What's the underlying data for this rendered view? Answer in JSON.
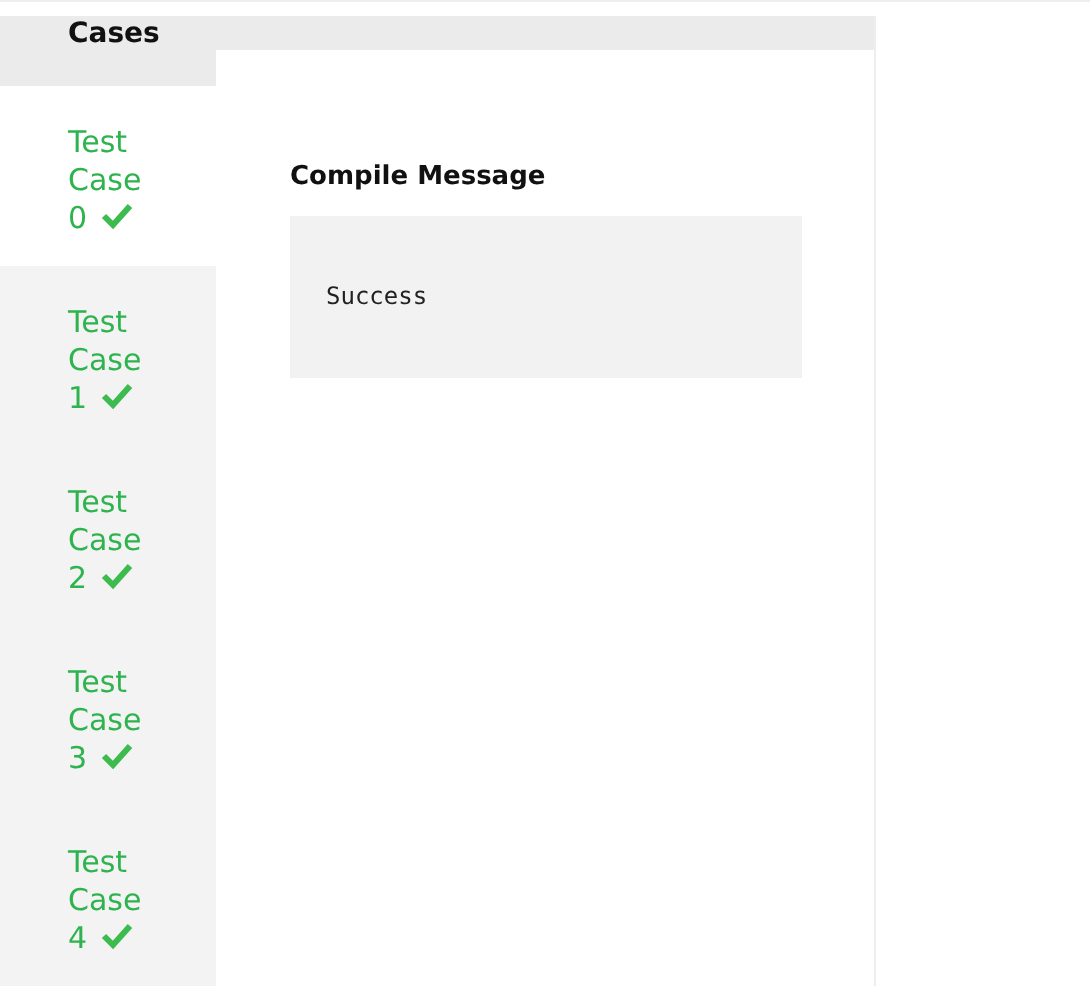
{
  "sidebar": {
    "title": "Cases",
    "items": [
      {
        "label": "Test Case 0",
        "selected": true,
        "passed": true
      },
      {
        "label": "Test Case 1",
        "selected": false,
        "passed": true
      },
      {
        "label": "Test Case 2",
        "selected": false,
        "passed": true
      },
      {
        "label": "Test Case 3",
        "selected": false,
        "passed": true
      },
      {
        "label": "Test Case 4",
        "selected": false,
        "passed": true
      }
    ]
  },
  "main": {
    "heading": "Compile Message",
    "message": "Success"
  }
}
